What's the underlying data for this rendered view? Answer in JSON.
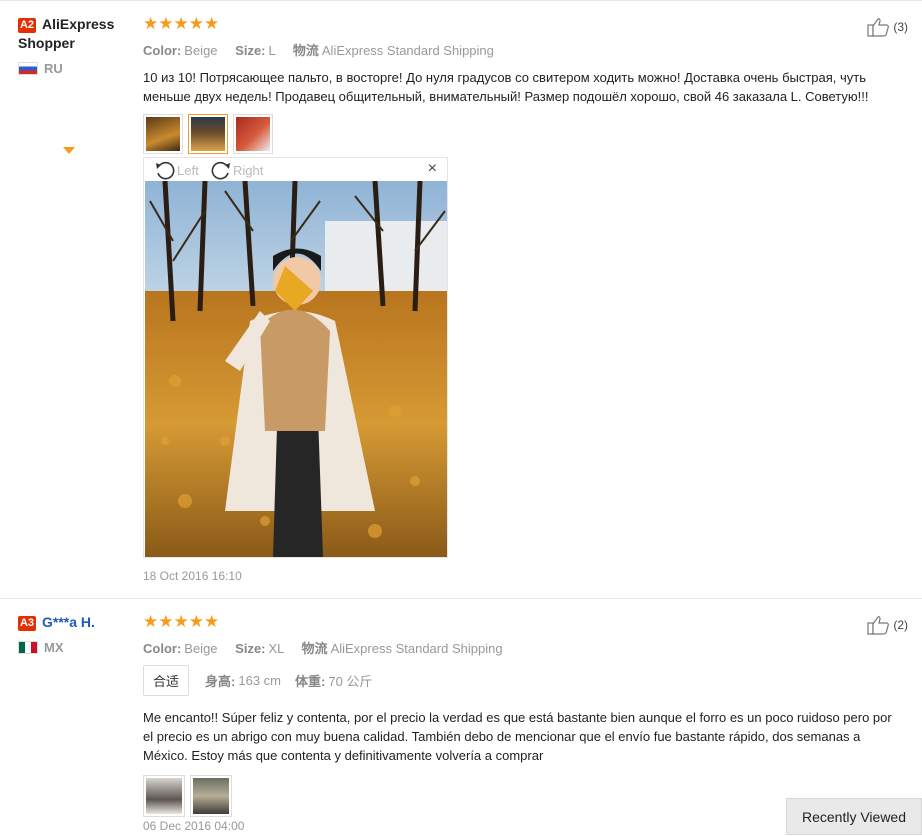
{
  "reviews": [
    {
      "level": "A2",
      "name": "AliExpress Shopper",
      "country": "RU",
      "stars": "★★★★★",
      "color_label": "Color:",
      "color_value": "Beige",
      "size_label": "Size:",
      "size_value": "L",
      "shipping_label": "物流",
      "shipping_value": "AliExpress Standard Shipping",
      "text": "10 из 10! Потрясающее пальто, в восторге! До нуля градусов со свитером ходить можно! Доставка очень быстрая, чуть меньше двух недель! Продавец общительный, внимательный! Размер подошёл хорошо, свой 46 заказала L. Советую!!!",
      "helpful_count": "(3)",
      "date": "18 Oct 2016 16:10",
      "viewer": {
        "rotate_left": "Left",
        "rotate_right": "Right",
        "close": "×"
      }
    },
    {
      "level": "A3",
      "name": "G***a H.",
      "country": "MX",
      "stars": "★★★★★",
      "color_label": "Color:",
      "color_value": "Beige",
      "size_label": "Size:",
      "size_value": "XL",
      "shipping_label": "物流",
      "shipping_value": "AliExpress Standard Shipping",
      "fit_label": "合适",
      "height_label": "身高:",
      "height_value": "163 cm",
      "weight_label": "体重:",
      "weight_value": "70 公斤",
      "text": "Me encanto!! Súper feliz y contenta, por el precio la verdad es que está bastante bien aunque el forro es un poco ruidoso pero por el precio es un abrigo con muy buena calidad. También debo de mencionar que el envío fue bastante rápido, dos semanas a México. Estoy más que contenta y definitivamente volvería a comprar",
      "helpful_count": "(2)",
      "date": "06 Dec 2016 04:00"
    }
  ],
  "recently_viewed": "Recently Viewed",
  "colors": {
    "star": "#f79b1c",
    "level_badge": "#e62e04",
    "name_blue": "#1c5cb8"
  }
}
